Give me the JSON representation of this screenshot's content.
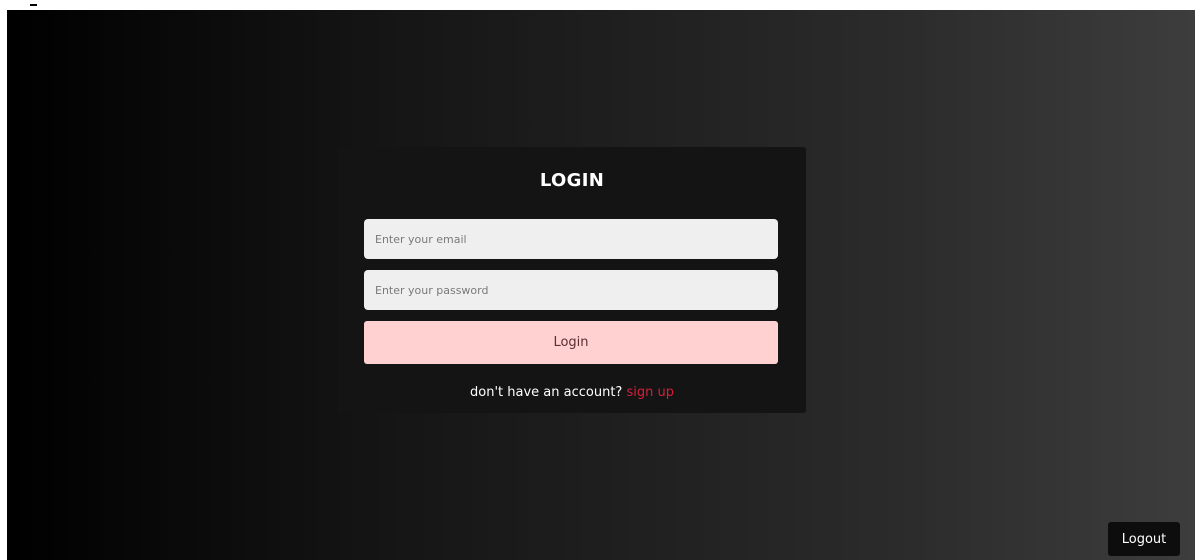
{
  "colors": {
    "background_start": "#000000",
    "background_end": "#3d3d3d",
    "card": "#141414",
    "input_background": "#efefef",
    "login_button": "#ffd1d1",
    "link_accent": "#d81e3a",
    "logout_button": "#0d0d0d"
  },
  "login_card": {
    "title": "LOGIN",
    "email_placeholder": "Enter your email",
    "email_value": "",
    "password_placeholder": "Enter your password",
    "password_value": "",
    "submit_label": "Login",
    "signup_prompt": "don't have an account?",
    "signup_link": "sign up"
  },
  "header": {
    "logout_label": "Logout"
  }
}
